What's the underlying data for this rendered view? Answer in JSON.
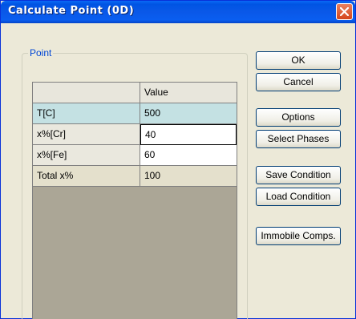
{
  "window": {
    "title": "Calculate Point (0D)"
  },
  "group": {
    "label": "Point"
  },
  "grid": {
    "header": {
      "name": "",
      "value": "Value"
    },
    "rows": [
      {
        "name": "T[C]",
        "value": "500"
      },
      {
        "name": "x%[Cr]",
        "value": "40"
      },
      {
        "name": "x%[Fe]",
        "value": "60"
      },
      {
        "name": "Total x%",
        "value": "100"
      }
    ]
  },
  "buttons": {
    "ok": "OK",
    "cancel": "Cancel",
    "options": "Options",
    "select_phases": "Select Phases",
    "save_condition": "Save Condition",
    "load_condition": "Load Condition",
    "immobile_comps": "Immobile Comps."
  },
  "colors": {
    "title_bar": "#0054e3",
    "temp_row": "#c4e1e3",
    "grid_empty": "#aba696",
    "group_label": "#0046d5"
  }
}
